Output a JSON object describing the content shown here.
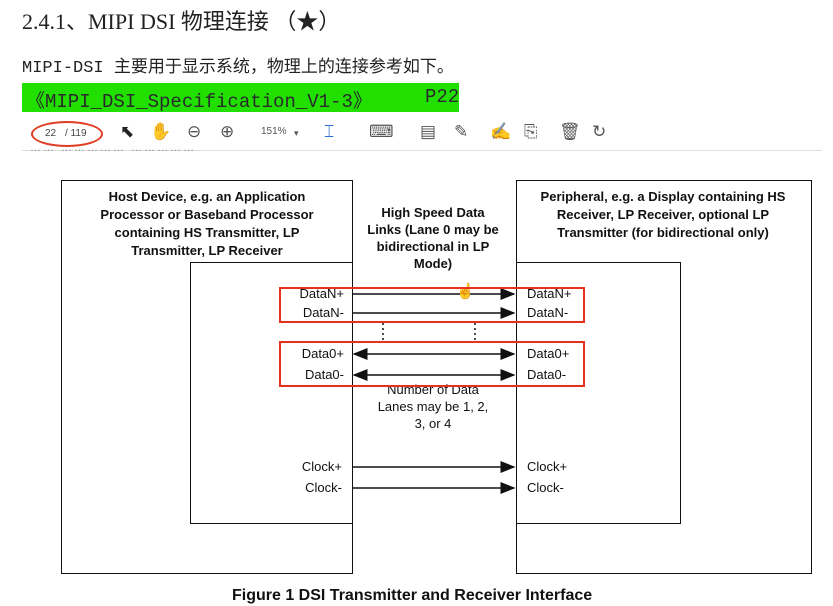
{
  "heading": "2.4.1、MIPI DSI 物理连接 （★）",
  "intro": "MIPI-DSI 主要用于显示系统，物理上的连接参考如下。",
  "reference": {
    "doc": "《MIPI_DSI_Specification_V1-3》",
    "page": "P22"
  },
  "toolbar": {
    "page_current": "22",
    "page_total": "/ 119",
    "zoom": "151%",
    "icons": [
      "select-arrow-icon",
      "hand-icon",
      "zoom-out-icon",
      "zoom-in-icon",
      "zoom-dropdown-icon",
      "fit-page-icon",
      "scroll-mode-icon",
      "comment-icon",
      "highlight-icon",
      "sign-icon",
      "stamp-icon",
      "delete-icon",
      "rotate-icon"
    ]
  },
  "truncated_line": "…… …………… ……………",
  "diagram": {
    "host": {
      "title": "Host Device, e.g. an Application Processor or Baseband Processor containing HS Transmitter, LP Transmitter,  LP Receiver"
    },
    "peripheral": {
      "title": "Peripheral, e.g. a Display containing  HS Receiver, LP Receiver, optional LP Transmitter (for bidirectional only)"
    },
    "links_label": "High Speed Data  Links (Lane 0 may be bidirectional in LP Mode)",
    "lanes_note": "Number of Data Lanes may be 1, 2, 3, or 4",
    "signals": [
      {
        "left": "DataN+",
        "right": "DataN+",
        "direction": "right"
      },
      {
        "left": "DataN-",
        "right": "DataN-",
        "direction": "right"
      },
      {
        "left": "Data0+",
        "right": "Data0+",
        "direction": "both"
      },
      {
        "left": "Data0-",
        "right": "Data0-",
        "direction": "both"
      },
      {
        "left": "Clock+",
        "right": "Clock+",
        "direction": "right"
      },
      {
        "left": "Clock-",
        "right": "Clock-",
        "direction": "right"
      }
    ],
    "caption": "Figure 1 DSI Transmitter and Receiver Interface",
    "highlight_color": "#e8301c"
  }
}
